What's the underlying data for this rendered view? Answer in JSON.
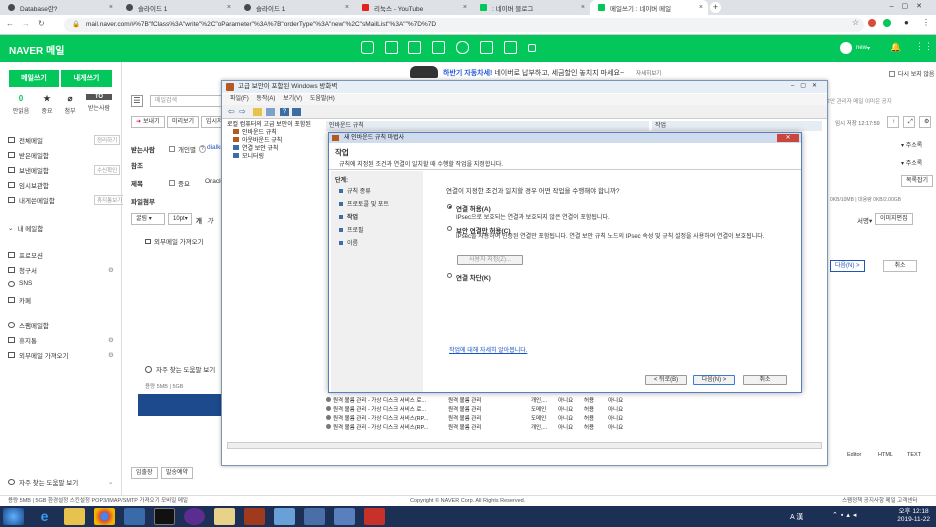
{
  "browser": {
    "tabs": [
      {
        "label": "Database란?",
        "color": "#4a4a4a"
      },
      {
        "label": "슬라이드 1",
        "color": "#4a4a4a"
      },
      {
        "label": "슬라이드 1",
        "color": "#4a4a4a"
      },
      {
        "label": "리눅스 - YouTube",
        "color": "#e62117"
      },
      {
        "label": ": 네이버 블로그",
        "color": "#03c75a"
      },
      {
        "label": "메일쓰기 : 네이버 메일",
        "color": "#03c75a"
      }
    ],
    "url": "mail.naver.com/#%7B\"fClass%3A\"write\"%2C\"oParameter\"%3A%7B\"orderType\"%3A\"new\"%2C\"sMailList\"%3A\"\"%7D%7D"
  },
  "naver": {
    "logo": "NAVER 메일",
    "user": "new",
    "ad_title": "하반기 자동차세!",
    "ad_text": "네이버로 납부하고, 세금할인 놓치지 마세요~",
    "ad_more": "자세히보기",
    "ad_check": "다시 보지 않음"
  },
  "sidebar": {
    "write_button": "메일쓰기",
    "self_button": "내게쓰기",
    "quick": [
      {
        "icon": "0",
        "label": "안읽음"
      },
      {
        "icon": "★",
        "label": "중요"
      },
      {
        "icon": "⌀",
        "label": "첨부"
      },
      {
        "icon": "TO",
        "label": "받는사람"
      }
    ],
    "folders": [
      {
        "label": "전체메일",
        "right": "정리하기"
      },
      {
        "label": "받은메일함",
        "right": ""
      },
      {
        "label": "보낸메일함",
        "right": "수신확인"
      },
      {
        "label": "임시보관함",
        "right": ""
      },
      {
        "label": "내게쓴메일함",
        "right": "휴지통보기"
      }
    ],
    "my_folder": "내 메일함",
    "others": [
      "프로모션",
      "청구서",
      "SNS",
      "카페"
    ],
    "bottom": [
      "스팸메일함",
      "휴지통",
      "외부메일 가져오기"
    ],
    "help": "자주 찾는 도움말 보기"
  },
  "compose": {
    "search_placeholder": "메일검색",
    "send": "보내기",
    "preview": "미리보기",
    "temp": "임시저장",
    "to_label": "받는사람",
    "cc_label": "참조",
    "subject_label": "제목",
    "attach_label": "파일첨부",
    "personal": "개인별",
    "important": "중요",
    "subject_value": "Oracle",
    "font": "굴림",
    "size": "10pt",
    "external": "외부메일 가져오기",
    "help": "자주 찾는 도움말 보기",
    "capacity": "(개인보안 관리자 메일 이미은 공지",
    "save_note": "임시 저장 12:17:59",
    "address_book": "주소록",
    "address_book2": "주소록",
    "clear_attach": "목록잡기",
    "size_info": "0KB/10MB | 대용량 0KB/2.00GB",
    "bottom_tags": [
      "임출장",
      "발송예약"
    ],
    "editor_tabs": [
      "Editor",
      "HTML",
      "TEXT"
    ],
    "sign": "서명",
    "image_edit": "이미지편집",
    "capacity_foot": "용량 5MB | 5GB",
    "next_side": "다음(N) >",
    "cancel_side": "취소"
  },
  "firewall": {
    "title": "고급 보안이 포함된 Windows 방화벽",
    "menu": [
      "파일(F)",
      "동작(A)",
      "보기(V)",
      "도움말(H)"
    ],
    "tree": [
      "로컬 컴퓨터의 고급 보안이 포함된",
      "인바운드 규칙",
      "아웃바운드 규칙",
      "연결 보안 규칙",
      "모니터링"
    ],
    "rule_header": "인바운드 규칙",
    "action_header": "작업",
    "rules": [
      {
        "name": "원격 볼륨 관리 - 가상 디스크 서비스 로...",
        "group": "원격 볼륨 관리",
        "profile": "개인,...",
        "enabled": "아니요",
        "action": "허용",
        "override": "아니요"
      },
      {
        "name": "원격 볼륨 관리 - 가상 디스크 서비스 로...",
        "group": "원격 볼륨 관리",
        "profile": "도메인",
        "enabled": "아니요",
        "action": "허용",
        "override": "아니요"
      },
      {
        "name": "원격 볼륨 관리 - 가상 디스크 서비스(RP...",
        "group": "원격 볼륨 관리",
        "profile": "도메인",
        "enabled": "아니요",
        "action": "허용",
        "override": "아니요"
      },
      {
        "name": "원격 볼륨 관리 - 가상 디스크 서비스(RP...",
        "group": "원격 볼륨 관리",
        "profile": "개인,...",
        "enabled": "아니요",
        "action": "허용",
        "override": "아니요"
      }
    ]
  },
  "wizard": {
    "title": "새 인바운드 규칙 마법사",
    "heading": "작업",
    "subtitle": "규칙에 지정된 조건과 연결이 일치할 때 수행할 작업을 지정합니다.",
    "steps_title": "단계:",
    "steps": [
      "규칙 종류",
      "프로토콜 및 포트",
      "작업",
      "프로필",
      "이름"
    ],
    "question": "연결이 지정한 조건과 일치할 경우 어떤 작업을 수행해야 합니까?",
    "opt1": "연결 허용(A)",
    "opt1_desc": "IPsec으로 보호되는 연결과 보호되지 않은 연결이 포함됩니다.",
    "opt2": "보안 연결만 허용(C)",
    "opt2_desc": "IPsec을 사용하여 인증된 연결만 포함됩니다. 연결 보안 규칙 노드의 IPsec 속성 및 규칙 설정을 사용하여 연결이 보호됩니다.",
    "custom": "사용자 지정(Z)...",
    "opt3": "연결 차단(K)",
    "link": "작업에 대해 자세히 알아봅니다.",
    "back": "< 뒤로(B)",
    "next": "다음(N) >",
    "cancel": "취소"
  },
  "footer": {
    "left": "용량 5MB | 5GB   환경설정   스킨설정   POP3/IMAP/SMTP 가져오기   모바일 메일",
    "center": "Copyright © NAVER Corp. All Rights Reserved.",
    "right": "스팸정책   공지사항   메일 고객센터"
  },
  "taskbar": {
    "time": "오후 12:18",
    "date": "2019-11-22",
    "ime": "A 漢"
  }
}
